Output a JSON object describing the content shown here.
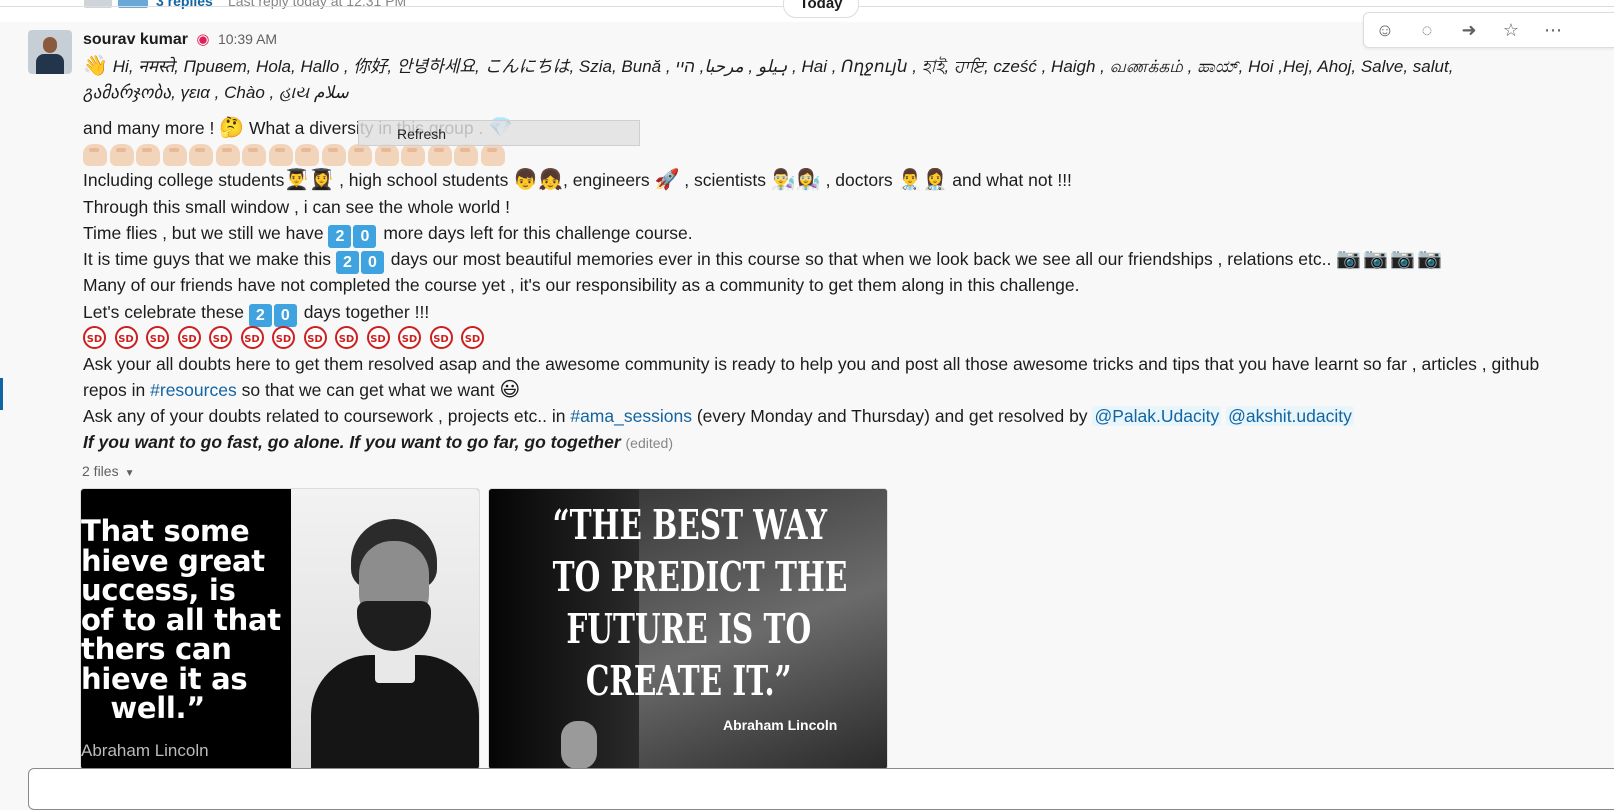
{
  "thread": {
    "replies": "3 replies",
    "last_reply": "Last reply today at 12:31 PM"
  },
  "divider": {
    "label": "Today"
  },
  "message": {
    "sender": "sourav kumar",
    "status_icon": "red-status-icon",
    "timestamp": "10:39 AM",
    "greeting_line1": "Hi, नमस्ते, Привет, Hola, Hallo , 你好, 안녕하세요, こんにちは, Szia, Bună , ہیلو , مرحبا, היי , Hai , Ողջույն , হাই, ਹਾਇ, cześć , Haigh , வணக்கம் , ಹಾಯ್, Hoi ,Hej, Ahoj, Salve, salut,",
    "greeting_line2": "გამარჯობა, γεια , Chào , હાય سلام",
    "line_diversity_a": "and many more !",
    "line_diversity_b": "What a diversity in this group .",
    "line_including_a": "Including college students",
    "line_including_b": ", high school students",
    "line_including_c": ", engineers",
    "line_including_d": ", scientists",
    "line_including_e": ", doctors",
    "line_including_f": "and what not !!!",
    "line_window": "Through this small window , i can see the whole world !",
    "line_time_a": "Time flies , but we still we have",
    "line_time_b": "more days left for this challenge course.",
    "line_memories_a": "It is time guys that we make this",
    "line_memories_b": "days our most beautiful memories ever in this course so that when we look back we see all our friendships , relations etc..",
    "line_friends": "Many of our friends have not completed the course yet , it's our responsibility as a community to get them along in this challenge.",
    "line_celebrate_a": "Let's celebrate these",
    "line_celebrate_b": "days together !!!",
    "sd_label": "SD",
    "line_ask1": "Ask your all doubts here to get them resolved asap and the awesome community is ready to help you and post all those awesome tricks and tips that you have learnt so far , articles , github",
    "line_repos_a": "repos in",
    "channel_resources": "#resources",
    "line_repos_b": "so that we can get what we want",
    "line_ask2_a": "Ask any of your doubts related to coursework , projects etc.. in",
    "channel_ama": "#ama_sessions",
    "line_ask2_b": "(every Monday and Thursday) and get resolved by",
    "mention1": "@Palak.Udacity",
    "mention2": "@akshit.udacity",
    "quote": "If you want to go fast, go alone. If you want to go far, go together",
    "edited": "(edited)",
    "keycap_2": "2",
    "keycap_0": "0",
    "clap_count": 16,
    "sd_count": 13,
    "camera_count": 4
  },
  "tooltip": {
    "label": "Refresh"
  },
  "toolbar": {
    "buttons": [
      "add-reaction-icon",
      "reply-thread-icon",
      "share-icon",
      "star-icon",
      "more-icon"
    ]
  },
  "files": {
    "label": "2 files",
    "image1": {
      "quote": "That some\nhieve great\nuccess, is\nof to all that\nthers can\nhieve it as\n   well.”",
      "author": "Abraham Lincoln"
    },
    "image2": {
      "quote": "“THE BEST WAY\nTO PREDICT THE\nFUTURE IS TO\nCREATE IT.”",
      "author": "Abraham Lincoln"
    }
  },
  "colors": {
    "link": "#1264a3",
    "sd_red": "#cc1f1f",
    "keycap_blue": "#3fa3e0"
  }
}
